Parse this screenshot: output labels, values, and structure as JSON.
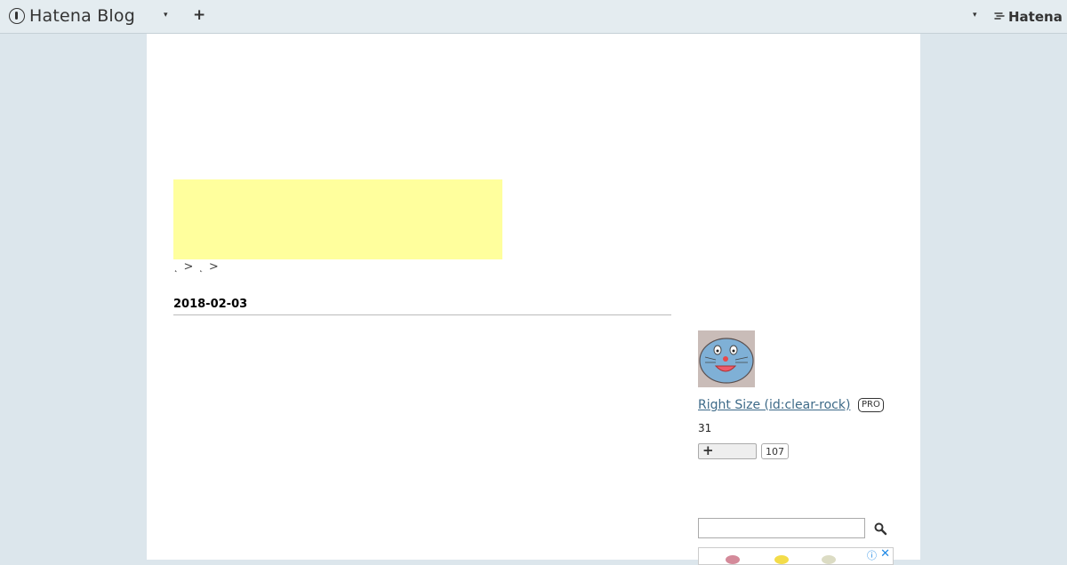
{
  "globalbar": {
    "brand": "Hatena Blog",
    "dropdown_icon": "▾",
    "add_icon": "+",
    "right_dropdown_icon": "▾",
    "hatena_label": "Hatena"
  },
  "breadcrumb": {
    "separator": ">"
  },
  "entry": {
    "date": "2018-02-03"
  },
  "sidebar": {
    "profile_name": "Right Size (id:clear-rock)",
    "pro_label": "PRO",
    "readers": "31",
    "subscribe_count": "107",
    "search_placeholder": ""
  },
  "colors": {
    "page_background": "#dce6ec",
    "ad_banner": "#ffff9d",
    "link": "#3d6a88"
  }
}
